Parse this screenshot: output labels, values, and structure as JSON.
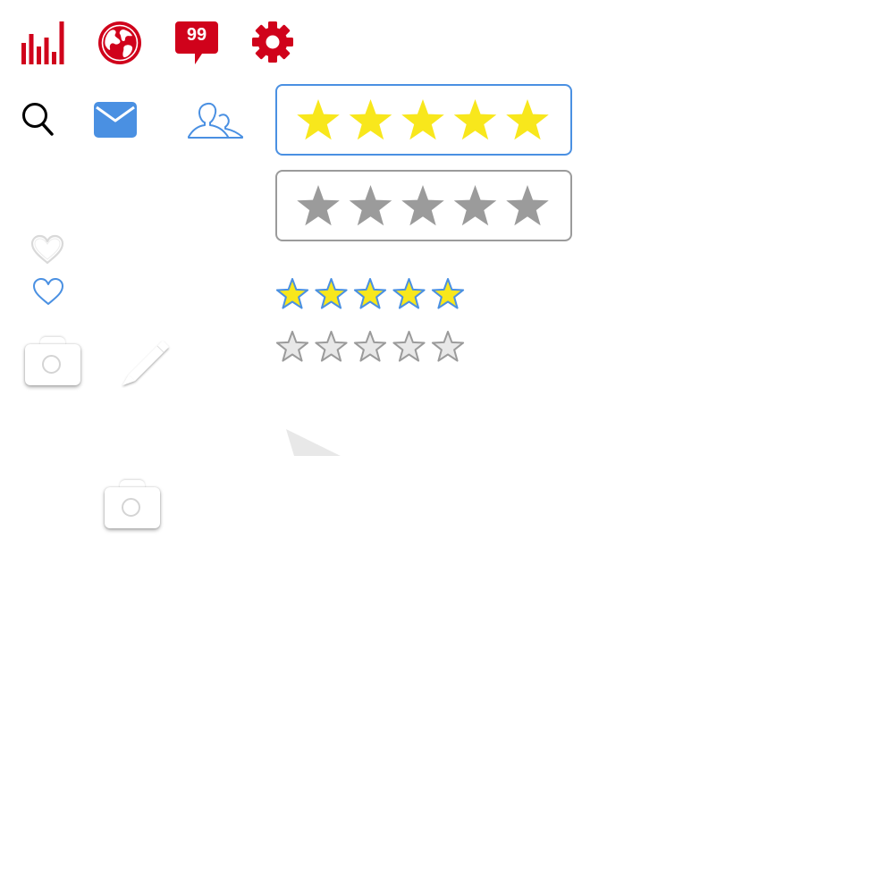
{
  "toolbar": {
    "stats_icon": "bar-chart-icon",
    "globe_icon": "globe-icon",
    "notifications": {
      "icon": "speech-bubble-icon",
      "count": "99"
    },
    "settings_icon": "gear-icon"
  },
  "secondary_icons": {
    "search_icon": "search-icon",
    "mail_icon": "envelope-icon",
    "people_icon": "users-icon"
  },
  "favorites": {
    "heart_outline_gray": "heart-outline-icon",
    "heart_outline_blue": "heart-outline-icon"
  },
  "media": {
    "camera_icon": "camera-icon",
    "edit_icon": "pencil-icon",
    "camera_icon_2": "camera-icon"
  },
  "ratings": {
    "max": 5,
    "selected_box_value": 5,
    "unselected_box_value": 0,
    "small_filled_value": 5,
    "small_empty_value": 0
  },
  "colors": {
    "brand_red": "#d0021b",
    "accent_blue": "#4a90e2",
    "star_yellow": "#f8e71c",
    "star_gray": "#9b9b9b",
    "star_empty_fill": "#e8e8e8"
  }
}
